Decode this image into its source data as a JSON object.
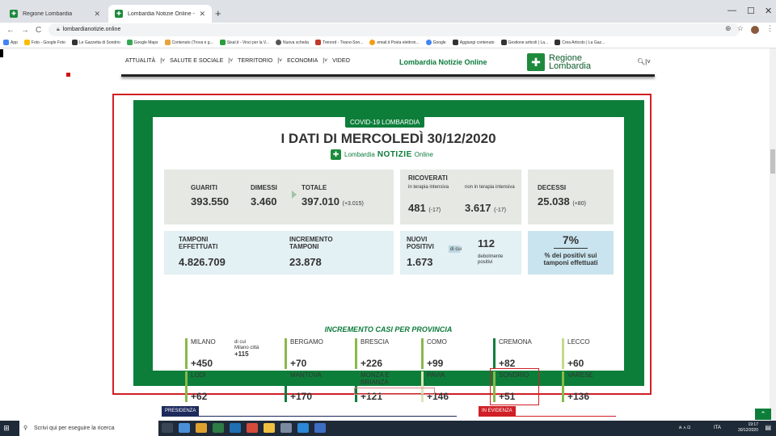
{
  "browser": {
    "tabs": [
      {
        "title": "Regione Lombardia"
      },
      {
        "title": "Lombardia Notizie Online - Homep"
      }
    ],
    "url": "lombardianotizie.online",
    "bookmarks": [
      "App",
      "Foto - Google Foto",
      "Le Gazzetta di Sondrio",
      "Google Maps",
      "Contenuto (Trova e g...",
      "Sisal.it - Vinci per la V...",
      "Nuova scheda",
      "Trenord - Tirano-Son...",
      "email.it Posta elettron...",
      "Google",
      "Aggiungi contenuto",
      "Gestione articoli | La...",
      "Crea Articolo | La Gaz..."
    ]
  },
  "site": {
    "nav": [
      "ATTUALITÀ",
      "SALUTE E SOCIALE",
      "TERRITORIO",
      "ECONOMIA",
      "VIDEO"
    ],
    "title": "Lombardia Notizie Online",
    "logo_line1": "Regione",
    "logo_line2": "Lombardia"
  },
  "infographic": {
    "tag": "COVID-19 LOMBARDIA",
    "title": "I DATI DI MERCOLEDÌ 30/12/2020",
    "logo_a": "Lombardia",
    "logo_b": "NOTIZIE",
    "logo_c": "Online",
    "guariti_label": "GUARITI",
    "guariti_value": "393.550",
    "dimessi_label": "DIMESSI",
    "dimessi_value": "3.460",
    "totale_label": "TOTALE",
    "totale_value": "397.010",
    "totale_delta": "(+3.015)",
    "ricoverati_label": "RICOVERATI",
    "ti_label": "in terapia intensiva",
    "ti_value": "481",
    "ti_delta": "(-17)",
    "nti_label": "non in terapia intensiva",
    "nti_value": "3.617",
    "nti_delta": "(-17)",
    "decessi_label": "DECESSI",
    "decessi_value": "25.038",
    "decessi_delta": "(+80)",
    "tamponi_label1": "TAMPONI",
    "tamponi_label2": "EFFETTUATI",
    "tamponi_value": "4.826.709",
    "incr_label1": "INCREMENTO",
    "incr_label2": "TAMPONI",
    "incr_value": "23.878",
    "nuovi_label1": "NUOVI",
    "nuovi_label2": "POSITIVI",
    "nuovi_value": "1.673",
    "dicui": "di cui",
    "deb_value": "112",
    "deb_label": "debolmente positivi",
    "pct_value": "7%",
    "pct_label": "% dei positivi sui tamponi effettuati",
    "prov_title": "INCREMENTO CASI PER PROVINCIA",
    "milano_note1": "di cui",
    "milano_note2": "Milano città",
    "milano_note_value": "+115",
    "provinces": [
      {
        "name": "MILANO",
        "value": "+450"
      },
      {
        "name": "BERGAMO",
        "value": "+70"
      },
      {
        "name": "BRESCIA",
        "value": "+226"
      },
      {
        "name": "COMO",
        "value": "+99"
      },
      {
        "name": "CREMONA",
        "value": "+82"
      },
      {
        "name": "LECCO",
        "value": "+60"
      },
      {
        "name": "LODI",
        "value": "+62"
      },
      {
        "name": "MANTOVA",
        "value": "+170"
      },
      {
        "name": "MONZA E BRIANZA",
        "value": "+121"
      },
      {
        "name": "PAVIA",
        "value": "+146"
      },
      {
        "name": "SONDRIO",
        "value": "+51"
      },
      {
        "name": "VARESE",
        "value": "+136"
      }
    ]
  },
  "sections": {
    "left": "PRESIDENZA",
    "right": "IN EVIDENZA"
  },
  "taskbar": {
    "search_placeholder": "Scrivi qui per eseguire la ricerca",
    "lang": "ITA",
    "time": "19:17",
    "date": "30/12/2020"
  },
  "colors": {
    "green": "#0d7e3a",
    "red": "#d01f26",
    "navy": "#1d2a5c"
  }
}
